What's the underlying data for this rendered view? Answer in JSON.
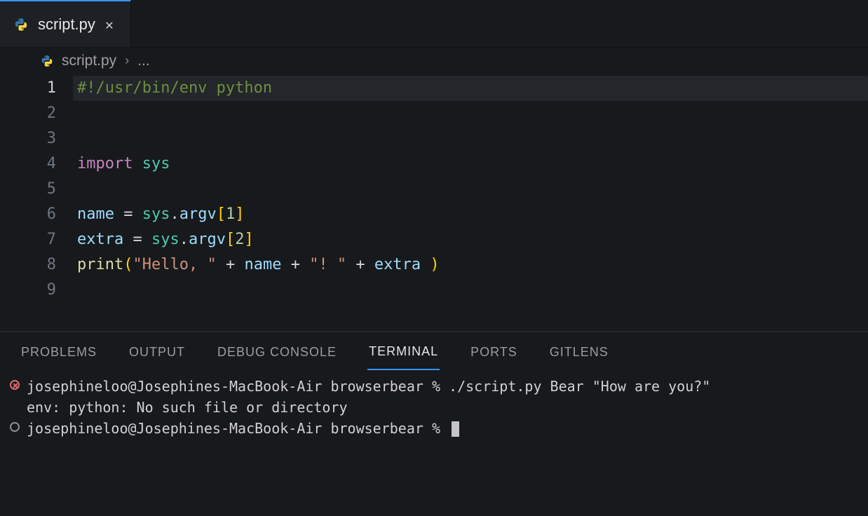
{
  "tab": {
    "filename": "script.py",
    "close_tooltip": "Close"
  },
  "breadcrumb": {
    "filename": "script.py",
    "rest": "..."
  },
  "editor": {
    "lines": [
      {
        "n": 1,
        "tokens": [
          [
            "c-comment",
            "#!/usr/bin/env python"
          ]
        ],
        "hl": true
      },
      {
        "n": 2,
        "tokens": []
      },
      {
        "n": 3,
        "tokens": [
          [
            "c-kw",
            "import"
          ],
          [
            "c-txt",
            " "
          ],
          [
            "c-mod",
            "sys"
          ]
        ]
      },
      {
        "n": 4,
        "tokens": []
      },
      {
        "n": 5,
        "tokens": [
          [
            "c-var",
            "name"
          ],
          [
            "c-txt",
            " "
          ],
          [
            "c-txt",
            "="
          ],
          [
            "c-txt",
            " "
          ],
          [
            "c-mod",
            "sys"
          ],
          [
            "c-txt",
            "."
          ],
          [
            "c-var",
            "argv"
          ],
          [
            "c-brkt",
            "["
          ],
          [
            "c-num",
            "1"
          ],
          [
            "c-brkt",
            "]"
          ]
        ]
      },
      {
        "n": 6,
        "tokens": [
          [
            "c-var",
            "extra"
          ],
          [
            "c-txt",
            " "
          ],
          [
            "c-txt",
            "="
          ],
          [
            "c-txt",
            " "
          ],
          [
            "c-mod",
            "sys"
          ],
          [
            "c-txt",
            "."
          ],
          [
            "c-var",
            "argv"
          ],
          [
            "c-brkt",
            "["
          ],
          [
            "c-num",
            "2"
          ],
          [
            "c-brkt",
            "]"
          ]
        ]
      },
      {
        "n": 7,
        "tokens": [
          [
            "c-fn",
            "print"
          ],
          [
            "c-brkt",
            "("
          ],
          [
            "c-str",
            "\"Hello, \""
          ],
          [
            "c-txt",
            " "
          ],
          [
            "c-txt",
            "+"
          ],
          [
            "c-txt",
            " "
          ],
          [
            "c-var",
            "name"
          ],
          [
            "c-txt",
            " "
          ],
          [
            "c-txt",
            "+"
          ],
          [
            "c-txt",
            " "
          ],
          [
            "c-str",
            "\"! \""
          ],
          [
            "c-txt",
            " "
          ],
          [
            "c-txt",
            "+"
          ],
          [
            "c-txt",
            " "
          ],
          [
            "c-var",
            "extra"
          ],
          [
            "c-txt",
            " "
          ],
          [
            "c-brkt",
            ")"
          ]
        ]
      },
      {
        "n": 8,
        "tokens": []
      },
      {
        "n": 9,
        "tokens": []
      }
    ]
  },
  "panel": {
    "tabs": [
      "PROBLEMS",
      "OUTPUT",
      "DEBUG CONSOLE",
      "TERMINAL",
      "PORTS",
      "GITLENS"
    ],
    "active": "TERMINAL"
  },
  "terminal": {
    "rows": [
      {
        "status": "error",
        "lines": [
          "josephineloo@Josephines-MacBook-Air browserbear % ./script.py Bear \"How are you?\"",
          "env: python: No such file or directory"
        ]
      },
      {
        "status": "idle",
        "lines": [
          "josephineloo@Josephines-MacBook-Air browserbear % "
        ],
        "cursor": true
      }
    ]
  }
}
